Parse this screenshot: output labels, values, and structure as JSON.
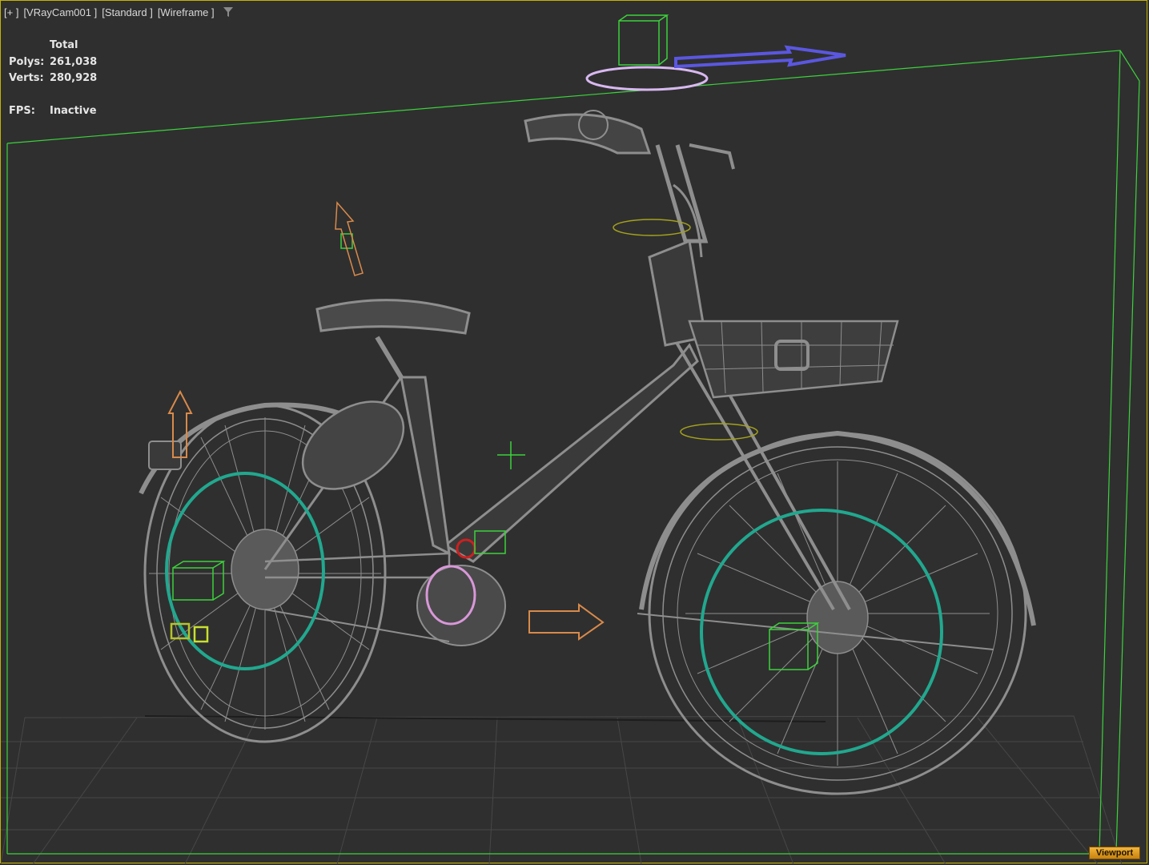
{
  "viewport_menu": {
    "plus": "[+ ]",
    "camera": "[VRayCam001 ]",
    "shading": "[Standard ]",
    "display": "[Wireframe ]",
    "filter_icon": "funnel-icon"
  },
  "stats": {
    "header": "Total",
    "polys_label": "Polys:",
    "polys_value": "261,038",
    "verts_label": "Verts:",
    "verts_value": "280,928",
    "fps_label": "FPS:",
    "fps_value": "Inactive"
  },
  "viewport_badge": "Viewport",
  "colors": {
    "background": "#2f2f2f",
    "border": "#c8b400",
    "wireframe": "#8e8e8e",
    "grid": "#474747",
    "teal_helper": "#21a88f",
    "green_helper": "#3cd23c",
    "blue_arrow": "#5b57e0",
    "orange_arrow": "#d98a4a",
    "pink_helper": "#d898d8",
    "red_helper": "#cc2020"
  }
}
